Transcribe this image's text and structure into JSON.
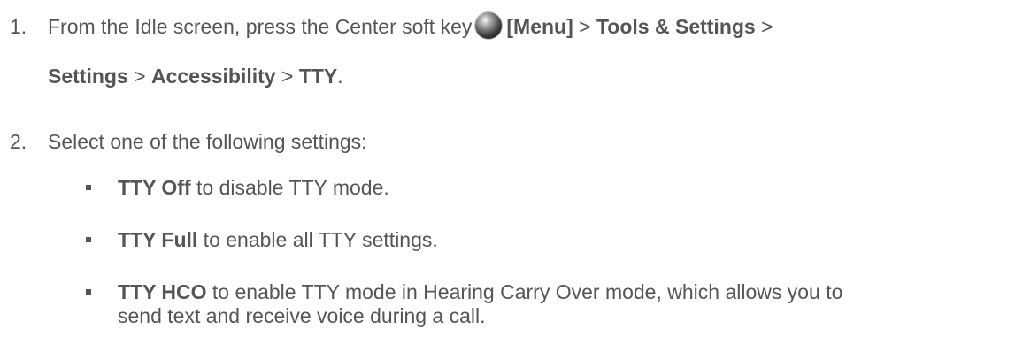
{
  "step1": {
    "number": "1.",
    "intro": "From the Idle screen, press the Center soft key",
    "key_label": "[Menu]",
    "sep": ">",
    "path1": "Tools & Settings",
    "path2": "Settings",
    "path3": "Accessibility",
    "path4": "TTY",
    "end": "."
  },
  "step2": {
    "number": "2.",
    "text": "Select one of the following settings:"
  },
  "bullets": [
    {
      "term": "TTY Off",
      "desc": " to disable TTY mode."
    },
    {
      "term": "TTY Full",
      "desc": " to enable all TTY settings."
    },
    {
      "term": "TTY HCO",
      "desc": " to enable TTY mode in Hearing Carry Over mode, which allows you to",
      "desc2": "send text and receive voice during a call."
    }
  ],
  "icons": {
    "center_soft_key": "center-soft-key-icon"
  }
}
